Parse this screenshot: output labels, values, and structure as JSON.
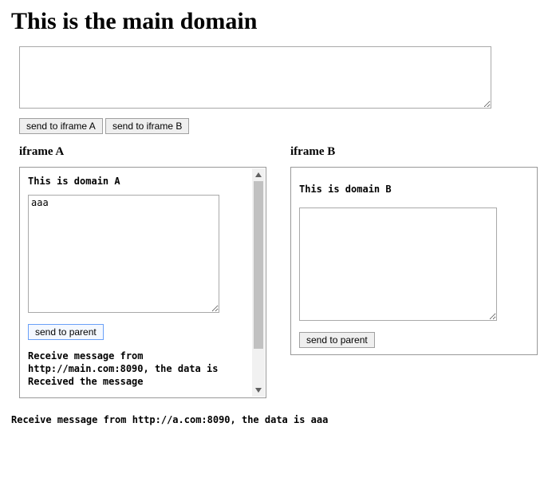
{
  "title": "This is the main domain",
  "main_textarea_value": "",
  "buttons": {
    "send_iframe_a": "send to iframe A",
    "send_iframe_b": "send to iframe B"
  },
  "iframe_a": {
    "heading": "iframe A",
    "domain_title": "This is domain A",
    "textarea_value": "aaa",
    "send_parent_label": "send to parent",
    "receive_text": "Receive message from http://main.com:8090, the data is Received the message"
  },
  "iframe_b": {
    "heading": "iframe B",
    "domain_title": "This is domain B",
    "textarea_value": "",
    "send_parent_label": "send to parent"
  },
  "bottom_receive_text": "Receive message from http://a.com:8090, the data is aaa"
}
